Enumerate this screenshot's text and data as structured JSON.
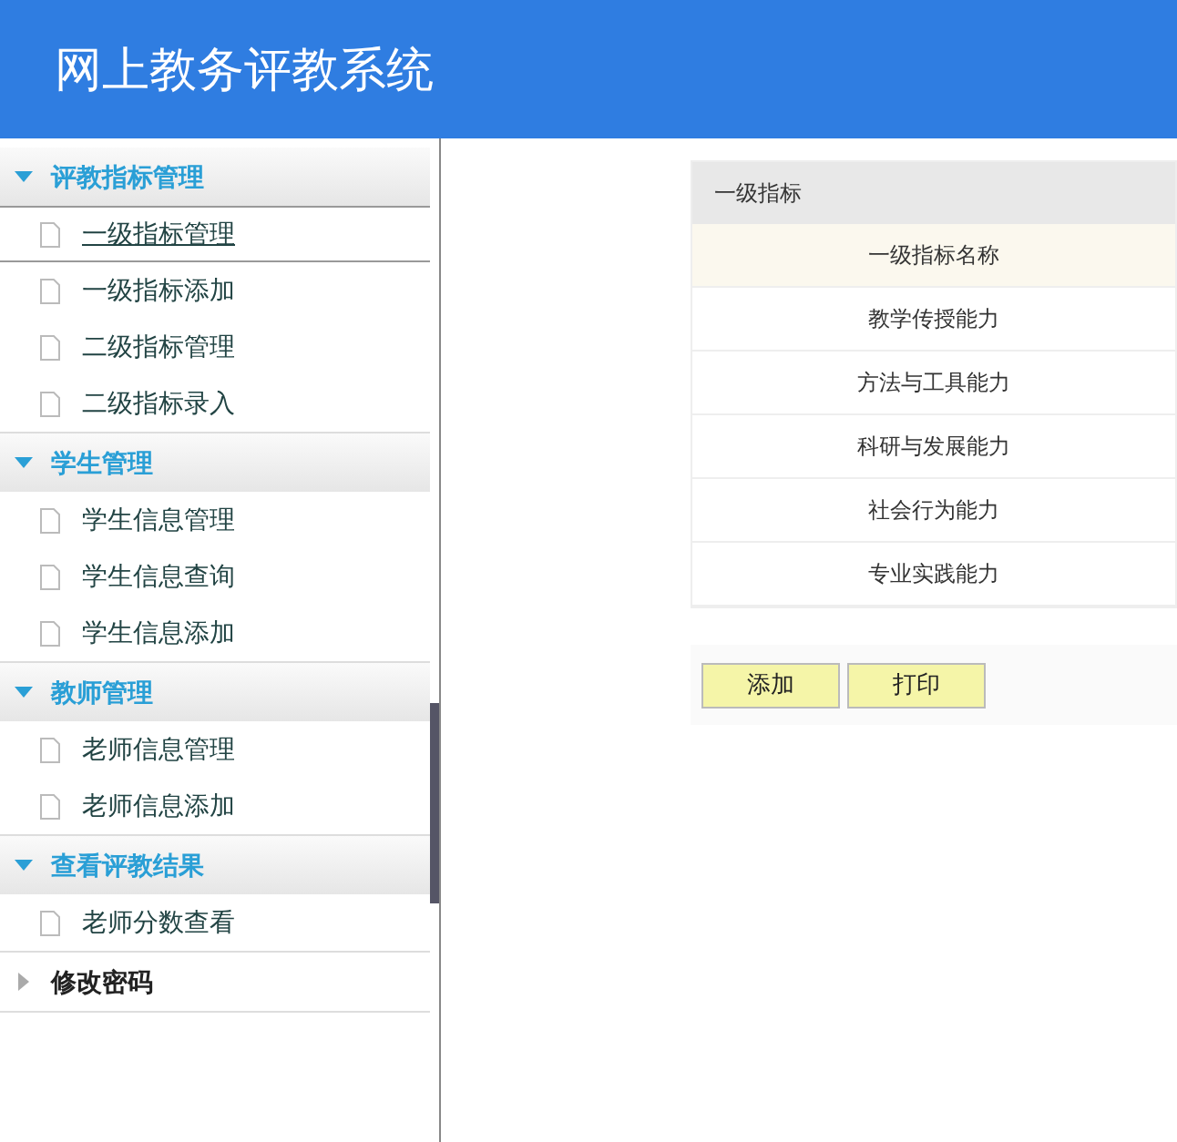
{
  "header": {
    "title": "网上教务评教系统"
  },
  "sidebar": {
    "groups": [
      {
        "label": "评教指标管理",
        "expanded": true,
        "items": [
          {
            "label": "一级指标管理",
            "selected": true
          },
          {
            "label": "一级指标添加",
            "selected": false
          },
          {
            "label": "二级指标管理",
            "selected": false
          },
          {
            "label": "二级指标录入",
            "selected": false
          }
        ]
      },
      {
        "label": "学生管理",
        "expanded": true,
        "items": [
          {
            "label": "学生信息管理",
            "selected": false
          },
          {
            "label": "学生信息查询",
            "selected": false
          },
          {
            "label": "学生信息添加",
            "selected": false
          }
        ]
      },
      {
        "label": "教师管理",
        "expanded": true,
        "items": [
          {
            "label": "老师信息管理",
            "selected": false
          },
          {
            "label": "老师信息添加",
            "selected": false
          }
        ]
      },
      {
        "label": "查看评教结果",
        "expanded": true,
        "items": [
          {
            "label": "老师分数查看",
            "selected": false
          }
        ]
      },
      {
        "label": "修改密码",
        "expanded": false
      }
    ]
  },
  "table": {
    "title": "一级指标",
    "columns": [
      "一级指标名称"
    ],
    "rows": [
      [
        "教学传授能力"
      ],
      [
        "方法与工具能力"
      ],
      [
        "科研与发展能力"
      ],
      [
        "社会行为能力"
      ],
      [
        "专业实践能力"
      ]
    ]
  },
  "buttons": [
    "添加",
    "打印"
  ]
}
